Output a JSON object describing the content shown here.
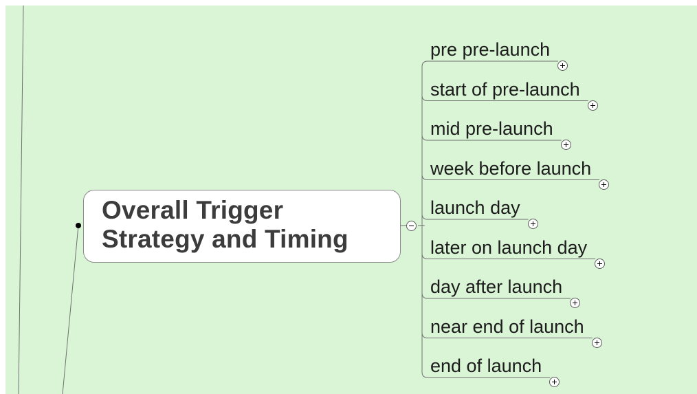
{
  "central_topic": {
    "line1": "Overall Trigger",
    "line2": "Strategy and Timing"
  },
  "subtopics": [
    "pre pre-launch",
    "start of pre-launch",
    "mid pre-launch",
    "week before launch",
    "launch day",
    "later on launch day",
    "day after launch",
    "near end of launch",
    "end of launch"
  ],
  "colors": {
    "background": "#d9f5d6",
    "connector": "#6f6f6f",
    "central_fill": "#ffffff",
    "text": "#1c1c1c"
  },
  "icons": {
    "collapse": "minus-circle-icon",
    "expand": "plus-circle-icon"
  }
}
